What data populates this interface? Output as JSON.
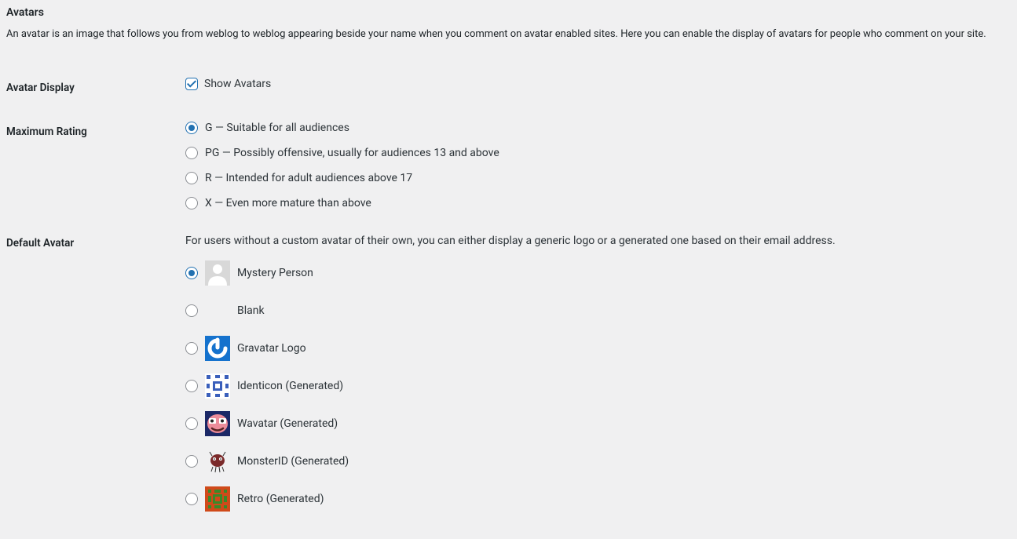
{
  "section": {
    "title": "Avatars",
    "description": "An avatar is an image that follows you from weblog to weblog appearing beside your name when you comment on avatar enabled sites. Here you can enable the display of avatars for people who comment on your site."
  },
  "avatar_display": {
    "label": "Avatar Display",
    "checkbox_label": "Show Avatars",
    "checked": true
  },
  "maximum_rating": {
    "label": "Maximum Rating",
    "selected": "G",
    "options": [
      {
        "value": "G",
        "label": "G — Suitable for all audiences"
      },
      {
        "value": "PG",
        "label": "PG — Possibly offensive, usually for audiences 13 and above"
      },
      {
        "value": "R",
        "label": "R — Intended for adult audiences above 17"
      },
      {
        "value": "X",
        "label": "X — Even more mature than above"
      }
    ]
  },
  "default_avatar": {
    "label": "Default Avatar",
    "help": "For users without a custom avatar of their own, you can either display a generic logo or a generated one based on their email address.",
    "selected": "mystery",
    "options": [
      {
        "id": "mystery",
        "label": "Mystery Person",
        "icon": "mystery-person-icon"
      },
      {
        "id": "blank",
        "label": "Blank",
        "icon": "blank-icon"
      },
      {
        "id": "gravatar",
        "label": "Gravatar Logo",
        "icon": "gravatar-logo-icon"
      },
      {
        "id": "identicon",
        "label": "Identicon (Generated)",
        "icon": "identicon-icon"
      },
      {
        "id": "wavatar",
        "label": "Wavatar (Generated)",
        "icon": "wavatar-icon"
      },
      {
        "id": "monsterid",
        "label": "MonsterID (Generated)",
        "icon": "monsterid-icon"
      },
      {
        "id": "retro",
        "label": "Retro (Generated)",
        "icon": "retro-icon"
      }
    ]
  }
}
